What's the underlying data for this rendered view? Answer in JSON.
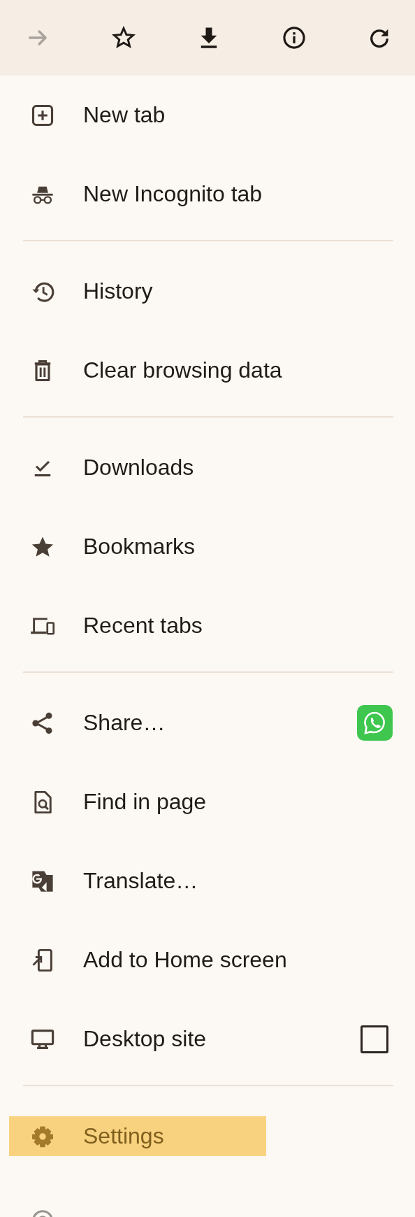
{
  "toolbar": [
    {
      "disabled": true
    },
    {
      "disabled": false
    },
    {
      "disabled": false
    },
    {
      "disabled": false
    },
    {
      "disabled": false
    }
  ],
  "menu": [
    {
      "kind": "plain",
      "label": "New tab",
      "selected": false
    },
    {
      "kind": "plain",
      "label": "New Incognito tab",
      "selected": false
    },
    {
      "kind": "divider"
    },
    {
      "kind": "plain",
      "label": "History",
      "selected": false
    },
    {
      "kind": "plain",
      "label": "Clear browsing data",
      "selected": false
    },
    {
      "kind": "divider"
    },
    {
      "kind": "plain",
      "label": "Downloads",
      "selected": false
    },
    {
      "kind": "plain",
      "label": "Bookmarks",
      "selected": false
    },
    {
      "kind": "plain",
      "label": "Recent tabs",
      "selected": false
    },
    {
      "kind": "divider"
    },
    {
      "kind": "share",
      "label": "Share…",
      "selected": false
    },
    {
      "kind": "plain",
      "label": "Find in page",
      "selected": false
    },
    {
      "kind": "plain",
      "label": "Translate…",
      "selected": false
    },
    {
      "kind": "plain",
      "label": "Add to Home screen",
      "selected": false
    },
    {
      "kind": "checkbox",
      "label": "Desktop site",
      "checked": false,
      "selected": false
    },
    {
      "kind": "divider"
    },
    {
      "kind": "plain",
      "label": "Settings",
      "selected": true
    }
  ]
}
